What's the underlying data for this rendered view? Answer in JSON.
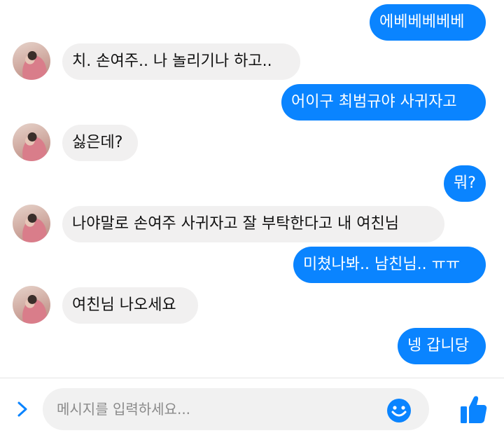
{
  "messages": [
    {
      "text": "에베베베베베",
      "sender": "me"
    },
    {
      "text": "치. 손여주.. 나 놀리기나 하고..",
      "sender": "them"
    },
    {
      "text": "어이구 최범규야 사귀자고",
      "sender": "me"
    },
    {
      "text": "싫은데?",
      "sender": "them"
    },
    {
      "text": "뭐?",
      "sender": "me"
    },
    {
      "text": "나야말로 손여주 사귀자고 잘 부탁한다고 내 여친님",
      "sender": "them"
    },
    {
      "text": "미쳤나봐.. 남친님.. ㅠㅠ",
      "sender": "me"
    },
    {
      "text": "여친님 나오세요",
      "sender": "them"
    },
    {
      "text": "넹 갑니당",
      "sender": "me"
    }
  ],
  "composer": {
    "placeholder": "메시지를 입력하세요...",
    "expand_icon": "chevron-right-icon",
    "emoji_icon": "smiley-icon",
    "like_icon": "thumbs-up-icon"
  },
  "colors": {
    "outgoing_bubble": "#0a84ff",
    "incoming_bubble": "#f1f0f0",
    "accent": "#0a84ff"
  }
}
